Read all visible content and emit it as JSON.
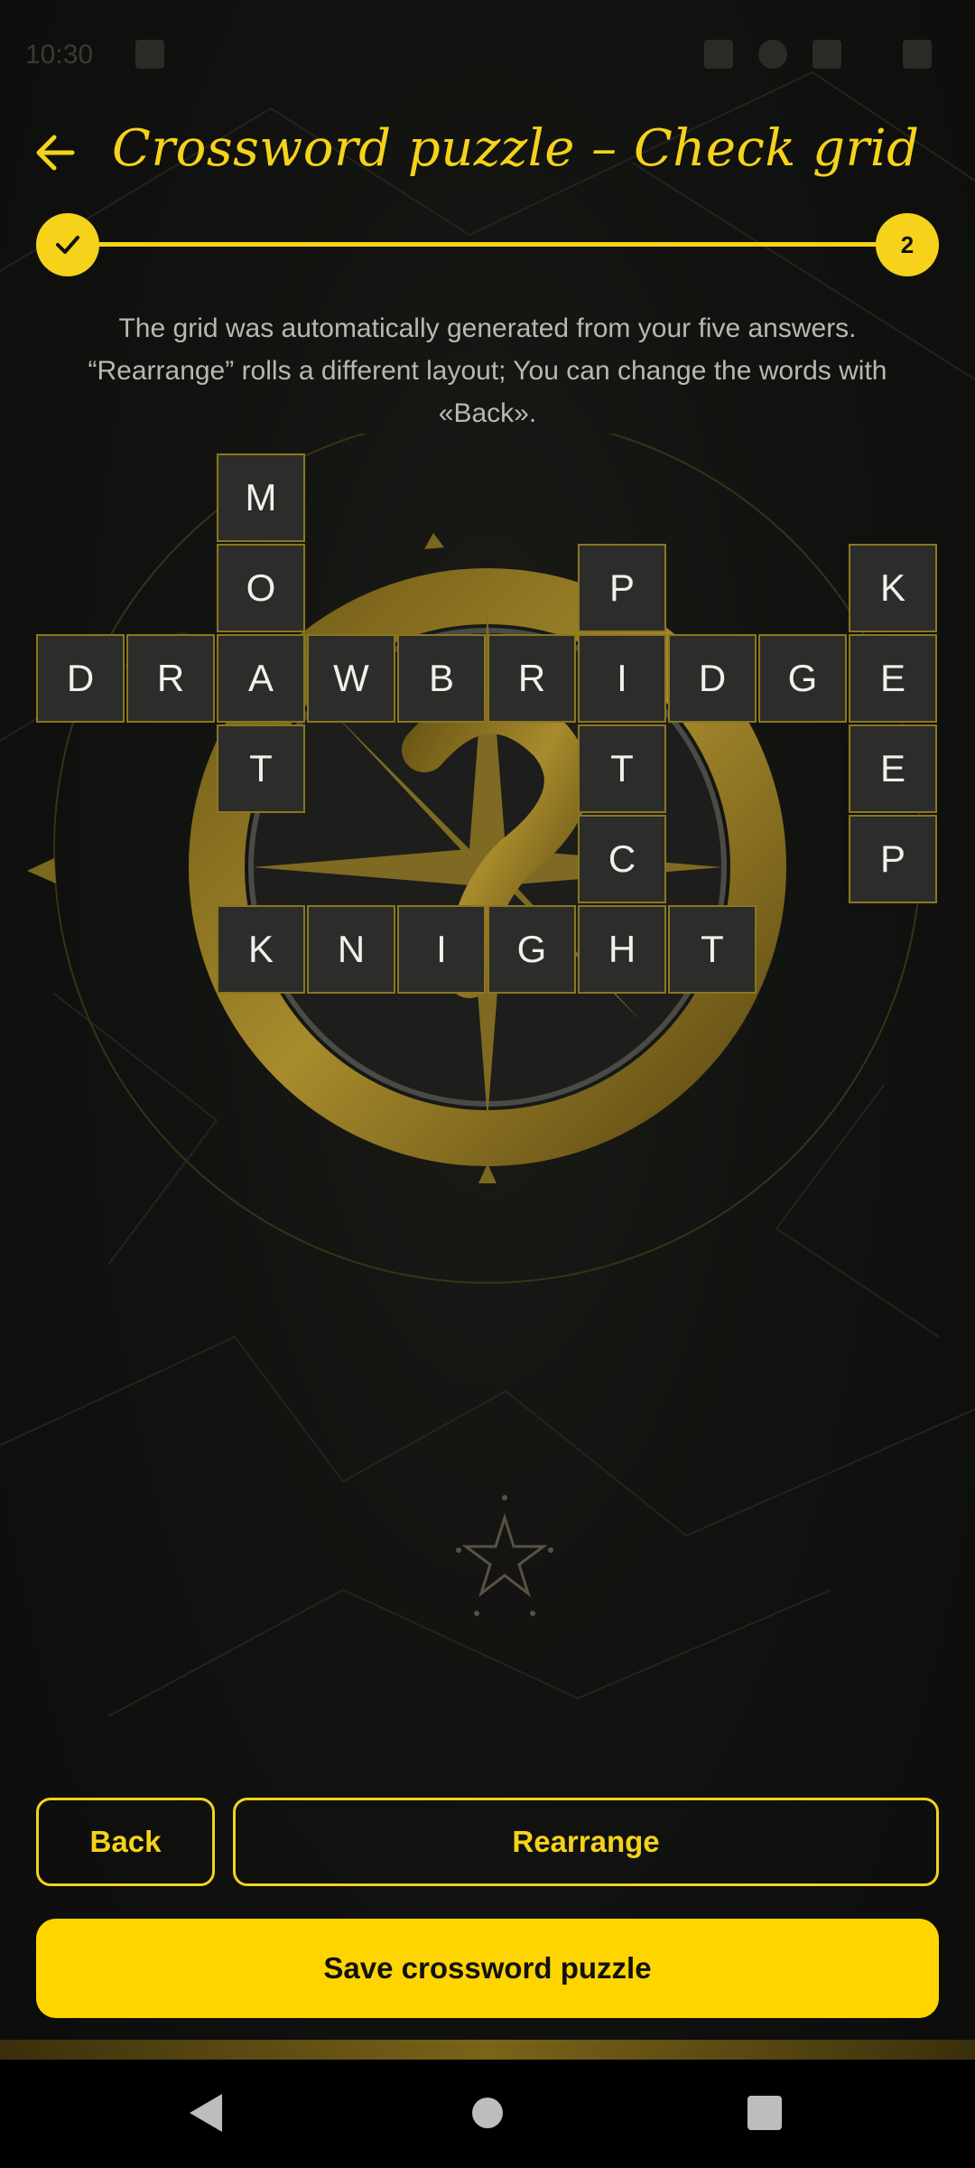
{
  "statusbar": {
    "time": "10:30"
  },
  "header": {
    "title": "Crossword puzzle – Check grid",
    "back_icon": "arrow-left-icon"
  },
  "stepper": {
    "step1_icon": "check-icon",
    "step2_label": "2"
  },
  "description": "The grid was automatically generated from your five answers. “Rearrange” rolls a different layout; You can change the words with «Back».",
  "grid": {
    "cells": [
      {
        "letter": "M"
      },
      {
        "letter": "O"
      },
      {
        "letter": "P"
      },
      {
        "letter": "K"
      },
      {
        "letter": "D"
      },
      {
        "letter": "R"
      },
      {
        "letter": "A"
      },
      {
        "letter": "W"
      },
      {
        "letter": "B"
      },
      {
        "letter": "R"
      },
      {
        "letter": "I"
      },
      {
        "letter": "D"
      },
      {
        "letter": "G"
      },
      {
        "letter": "E"
      },
      {
        "letter": "T"
      },
      {
        "letter": "T"
      },
      {
        "letter": "E"
      },
      {
        "letter": "C"
      },
      {
        "letter": "P"
      },
      {
        "letter": "K"
      },
      {
        "letter": "N"
      },
      {
        "letter": "I"
      },
      {
        "letter": "G"
      },
      {
        "letter": "H"
      },
      {
        "letter": "T"
      }
    ]
  },
  "buttons": {
    "back": "Back",
    "rearrange": "Rearrange",
    "save": "Save crossword puzzle"
  },
  "colors": {
    "accent": "#f6d21a",
    "button_fill": "#ffd500",
    "cell_bg": "#2c2c2a",
    "background": "#0e0f0d"
  },
  "navbar": {
    "back_icon": "nav-back-icon",
    "home_icon": "nav-home-icon",
    "recents_icon": "nav-recents-icon"
  }
}
